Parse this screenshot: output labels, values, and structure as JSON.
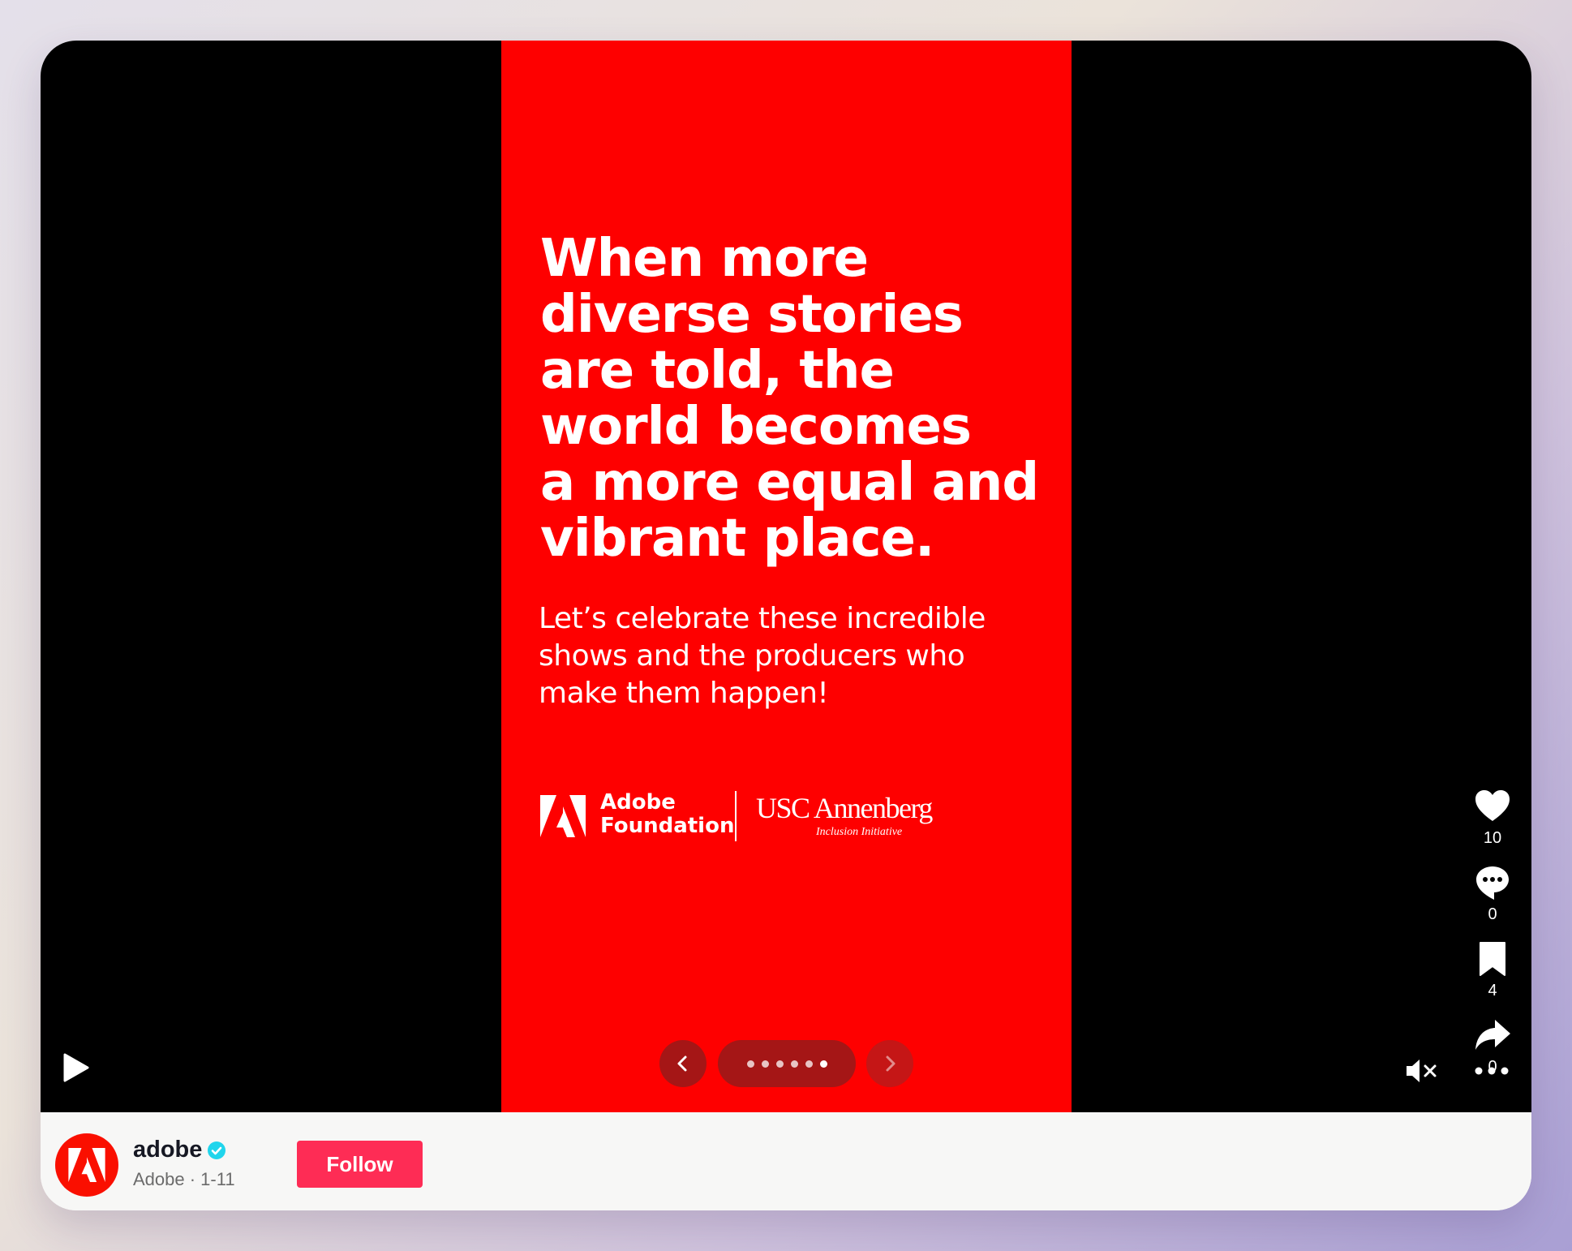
{
  "slide": {
    "headline": "When more\ndiverse stories\nare told, the\nworld becomes\na more equal and\nvibrant place.",
    "subtext": "Let’s celebrate these incredible\nshows and the producers who\nmake them happen!",
    "logos": {
      "adobe_foundation": "Adobe\nFoundation",
      "usc": "USC Annenberg",
      "usc_sub": "Inclusion Initiative"
    },
    "background_color": "#fe0000"
  },
  "carousel": {
    "total_slides": 6,
    "active_index": 5
  },
  "actions": {
    "likes": "10",
    "comments": "0",
    "saves": "4",
    "shares": "0"
  },
  "icons": [
    "play-icon",
    "heart-icon",
    "comment-icon",
    "bookmark-icon",
    "share-icon",
    "mute-icon",
    "more-icon",
    "chevron-left-icon",
    "chevron-right-icon",
    "verified-icon",
    "adobe-logo-icon"
  ],
  "author": {
    "username": "adobe",
    "meta": "Adobe · 1-11",
    "follow_label": "Follow"
  },
  "colors": {
    "accent": "#fe2c55",
    "adobe_red": "#fa0f00",
    "verified": "#20d5ec"
  }
}
